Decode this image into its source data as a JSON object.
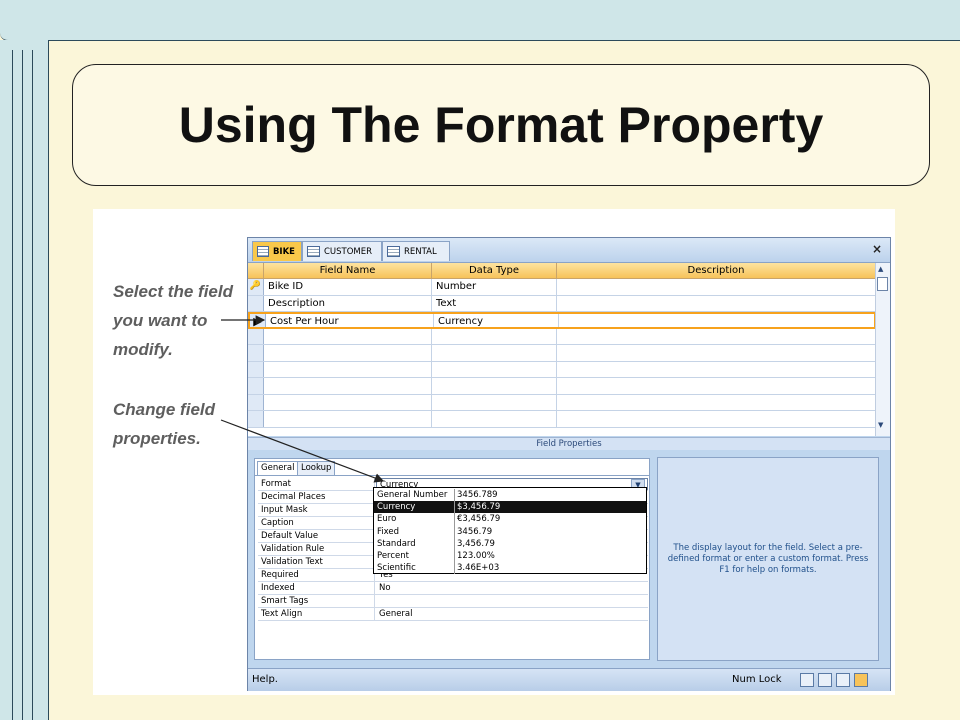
{
  "slide": {
    "title": "Using The Format Property",
    "callouts": [
      "Select the field you want to modify.",
      "Change field properties."
    ]
  },
  "access": {
    "tabs": [
      {
        "label": "BIKE",
        "active": true
      },
      {
        "label": "CUSTOMER",
        "active": false
      },
      {
        "label": "RENTAL",
        "active": false
      }
    ],
    "close_glyph": "×",
    "columns": [
      "Field Name",
      "Data Type",
      "Description"
    ],
    "rows": [
      {
        "field": "Bike ID",
        "type": "Number",
        "selector": "key-icon"
      },
      {
        "field": "Description",
        "type": "Text",
        "selector": ""
      },
      {
        "field": "Cost Per Hour",
        "type": "Currency",
        "selector": "row-pointer-icon"
      }
    ],
    "field_properties_label": "Field Properties",
    "property_tabs": [
      "General",
      "Lookup"
    ],
    "properties": [
      {
        "name": "Format",
        "value": "Currency"
      },
      {
        "name": "Decimal Places",
        "value": ""
      },
      {
        "name": "Input Mask",
        "value": ""
      },
      {
        "name": "Caption",
        "value": ""
      },
      {
        "name": "Default Value",
        "value": ""
      },
      {
        "name": "Validation Rule",
        "value": ""
      },
      {
        "name": "Validation Text",
        "value": ""
      },
      {
        "name": "Required",
        "value": "Yes"
      },
      {
        "name": "Indexed",
        "value": "No"
      },
      {
        "name": "Smart Tags",
        "value": ""
      },
      {
        "name": "Text Align",
        "value": "General"
      }
    ],
    "format_options": [
      {
        "name": "General Number",
        "example": "3456.789"
      },
      {
        "name": "Currency",
        "example": "$3,456.79"
      },
      {
        "name": "Euro",
        "example": "€3,456.79"
      },
      {
        "name": "Fixed",
        "example": "3456.79"
      },
      {
        "name": "Standard",
        "example": "3,456.79"
      },
      {
        "name": "Percent",
        "example": "123.00%"
      },
      {
        "name": "Scientific",
        "example": "3.46E+03"
      }
    ],
    "format_selected": "Currency",
    "help_text": "The display layout for the field.  Select a pre-defined format or enter a custom format.  Press F1 for help on formats.",
    "status_left": "Help.",
    "status_right": "Num Lock",
    "colors": {
      "accent": "#f7c35a",
      "frame": "#bfd6ee",
      "highlight": "#111111"
    }
  }
}
